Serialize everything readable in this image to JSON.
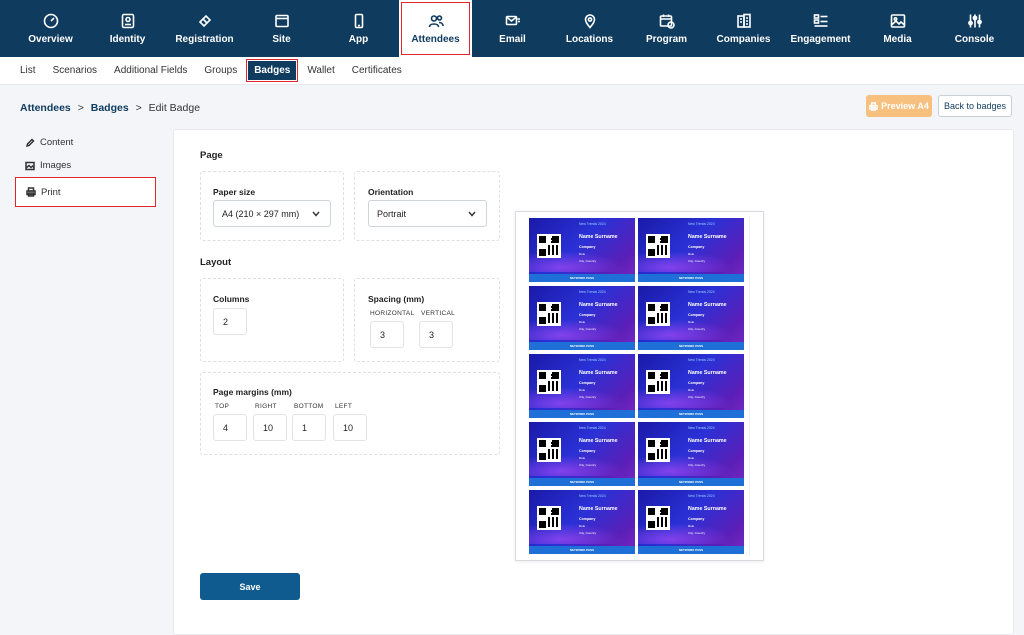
{
  "topnav": [
    {
      "label": "Overview",
      "icon": "gauge-icon"
    },
    {
      "label": "Identity",
      "icon": "id-card-icon"
    },
    {
      "label": "Registration",
      "icon": "ticket-icon"
    },
    {
      "label": "Site",
      "icon": "browser-icon"
    },
    {
      "label": "App",
      "icon": "phone-icon"
    },
    {
      "label": "Attendees",
      "icon": "users-icon"
    },
    {
      "label": "Email",
      "icon": "email-icon"
    },
    {
      "label": "Locations",
      "icon": "pin-icon"
    },
    {
      "label": "Program",
      "icon": "calendar-clock-icon"
    },
    {
      "label": "Companies",
      "icon": "buildings-icon"
    },
    {
      "label": "Engagement",
      "icon": "list-check-icon"
    },
    {
      "label": "Media",
      "icon": "image-icon"
    },
    {
      "label": "Console",
      "icon": "sliders-icon"
    }
  ],
  "subnav": [
    "List",
    "Scenarios",
    "Additional Fields",
    "Groups",
    "Badges",
    "Wallet",
    "Certificates"
  ],
  "breadcrumb": {
    "part1": "Attendees",
    "sep1": ">",
    "part2": "Badges",
    "sep2": ">",
    "current": "Edit Badge"
  },
  "actions": {
    "preview": "Preview A4",
    "back": "Back to badges"
  },
  "sidebar": [
    {
      "label": "Content",
      "icon": "pencil-icon"
    },
    {
      "label": "Images",
      "icon": "image-icon"
    },
    {
      "label": "Print",
      "icon": "printer-icon"
    }
  ],
  "page": {
    "heading": "Page",
    "paper_label": "Paper size",
    "paper_value": "A4 (210 × 297 mm)",
    "orientation_label": "Orientation",
    "orientation_value": "Portrait"
  },
  "layout": {
    "heading": "Layout",
    "columns_label": "Columns",
    "columns_value": "2",
    "spacing_label": "Spacing (mm)",
    "horizontal_label": "HORIZONTAL",
    "horizontal_value": "3",
    "vertical_label": "VERTICAL",
    "vertical_value": "3"
  },
  "margins": {
    "label": "Page margins (mm)",
    "top_label": "TOP",
    "top_value": "4",
    "right_label": "RIGHT",
    "right_value": "10",
    "bottom_label": "BOTTOM",
    "bottom_value": "1",
    "left_label": "LEFT",
    "left_value": "10"
  },
  "save_label": "Save",
  "badge": {
    "event": "New Trends 2024",
    "name": "Name Surname",
    "company": "Company",
    "role": "Role",
    "city": "City, Country",
    "footer": "NETWORK PASS"
  }
}
